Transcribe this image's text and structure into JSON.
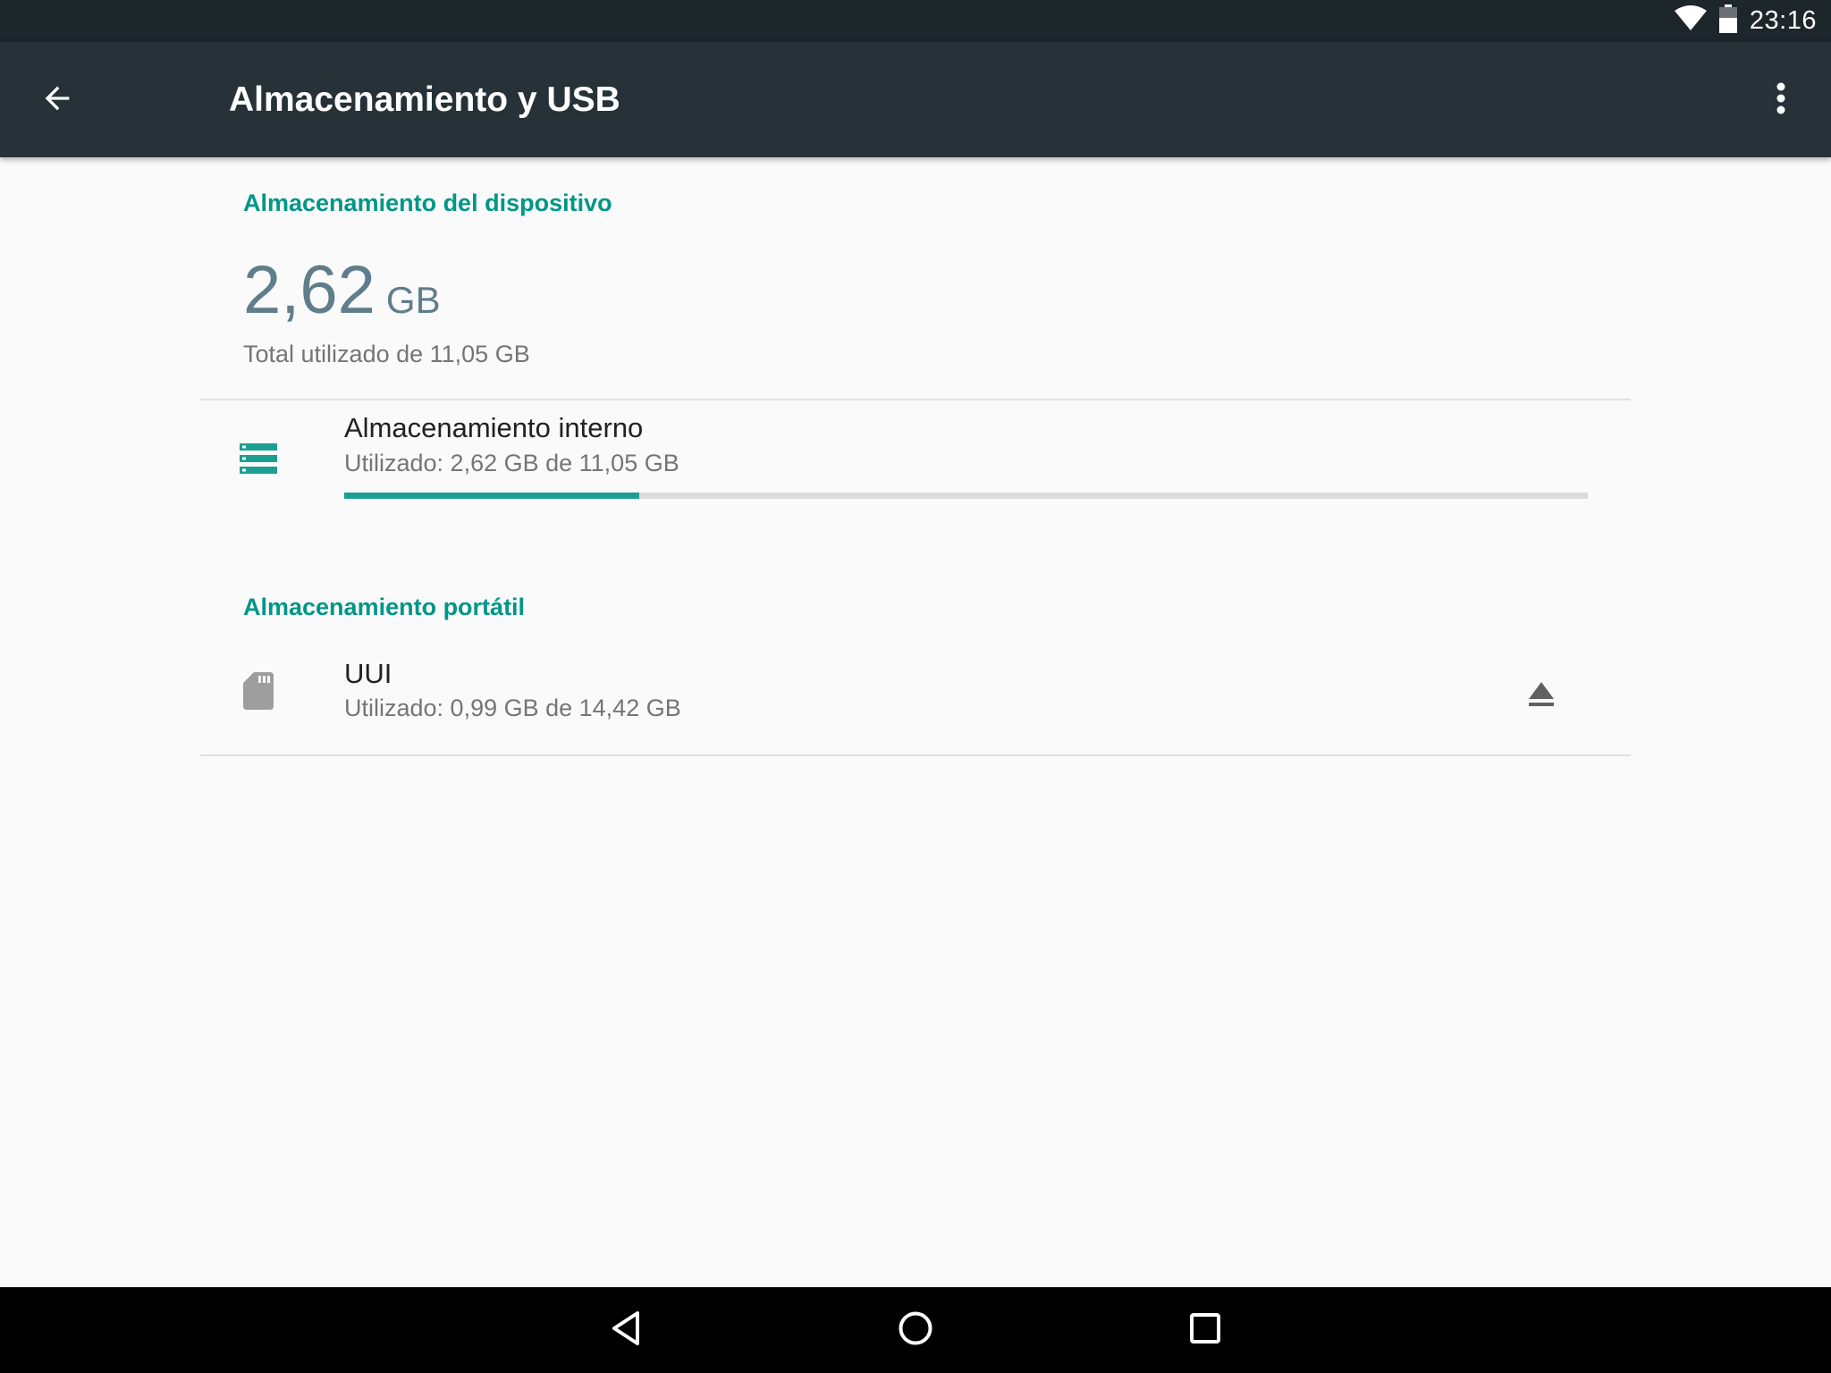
{
  "status_bar": {
    "time": "23:16",
    "icons": [
      "wifi-icon",
      "battery-icon"
    ]
  },
  "app_bar": {
    "title": "Almacenamiento y USB",
    "back_icon": "arrow-back-icon",
    "overflow_icon": "more-vert-icon"
  },
  "device_storage": {
    "header": "Almacenamiento del dispositivo",
    "used_value": "2,62",
    "used_unit": "GB",
    "total_text": "Total utilizado de 11,05 GB"
  },
  "internal_storage": {
    "icon": "storage-icon",
    "title": "Almacenamiento interno",
    "subtitle": "Utilizado: 2,62 GB de 11,05 GB",
    "used_fraction": 0.237
  },
  "portable_storage": {
    "header": "Almacenamiento portátil",
    "items": [
      {
        "icon": "sd-card-icon",
        "title": "UUI",
        "subtitle": "Utilizado: 0,99 GB de 14,42 GB",
        "action_icon": "eject-icon"
      }
    ]
  },
  "nav_bar": {
    "buttons": [
      "back-nav-icon",
      "home-nav-icon",
      "recents-nav-icon"
    ]
  },
  "colors": {
    "accent": "#009688",
    "toolbar": "#263238",
    "status_bar": "#1c262b",
    "summary_text": "#607d8b"
  }
}
